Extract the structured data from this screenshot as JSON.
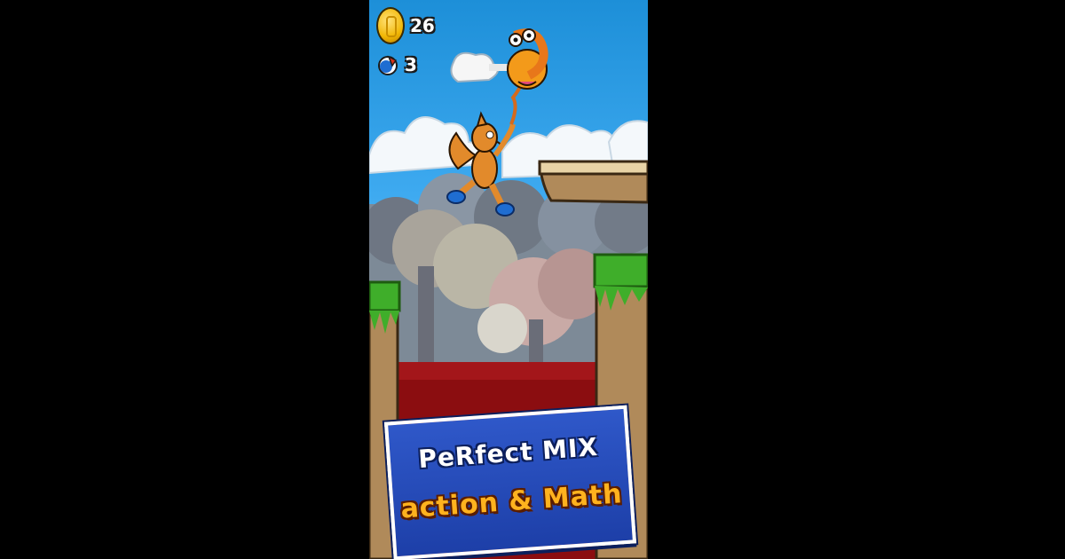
{
  "hud": {
    "coins": "26",
    "lives": "3",
    "coin_icon": "coin-icon",
    "lives_icon": "potion-icon"
  },
  "banner": {
    "line1": "PeRfect MIX",
    "line2": "action & Math"
  },
  "colors": {
    "sky": "#2f9fe0",
    "grass": "#3fae2a",
    "dirt": "#b08a5a",
    "lava": "#8b0d10",
    "banner_blue": "#1d3fa8",
    "banner_orange": "#ffb21e",
    "squirrel": "#e28a2b"
  },
  "characters": [
    "squirrel-player",
    "flying-number-monster"
  ]
}
